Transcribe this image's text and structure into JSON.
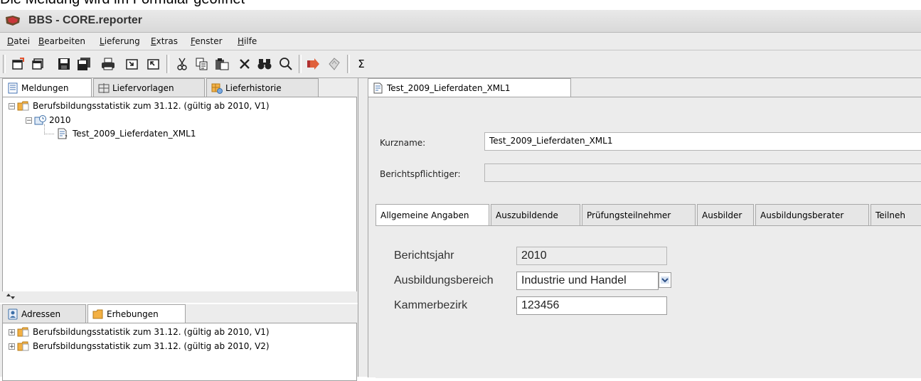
{
  "caption": "Die Meldung wird im Formular geöffnet",
  "window": {
    "title": "BBS - CORE.reporter"
  },
  "menu": [
    {
      "pre": "",
      "u": "D",
      "post": "atei"
    },
    {
      "pre": "",
      "u": "B",
      "post": "earbeiten"
    },
    {
      "pre": "",
      "u": "L",
      "post": "ieferung"
    },
    {
      "pre": "",
      "u": "E",
      "post": "xtras"
    },
    {
      "pre": "",
      "u": "F",
      "post": "enster"
    },
    {
      "pre": "",
      "u": "H",
      "post": "ilfe"
    }
  ],
  "toolbar": {
    "icons": [
      "new-report-icon",
      "new-multi-icon",
      "save-icon",
      "save-all-icon",
      "print-icon",
      "import-icon",
      "export-icon",
      "cut-icon",
      "copy-icon",
      "paste-icon",
      "delete-icon",
      "binoculars-icon",
      "search-icon",
      "send-icon",
      "validate-icon"
    ],
    "sigma": "Σ"
  },
  "left_top": {
    "tabs": [
      "Meldungen",
      "Liefervorlagen",
      "Lieferhistorie"
    ],
    "tree": {
      "root": "Berufsbildungsstatistik zum 31.12. (gültig ab 2010, V1)",
      "year": "2010",
      "leaf": "Test_2009_Lieferdaten_XML1"
    }
  },
  "left_bottom": {
    "tabs": [
      "Adressen",
      "Erhebungen"
    ],
    "tree": [
      "Berufsbildungsstatistik zum 31.12. (gültig ab 2010, V1)",
      "Berufsbildungsstatistik zum 31.12. (gültig ab 2010, V2)"
    ]
  },
  "editor": {
    "tab": "Test_2009_Lieferdaten_XML1",
    "kurzname_label": "Kurzname:",
    "kurzname_value": "Test_2009_Lieferdaten_XML1",
    "berichtspflichtiger_label": "Berichtspflichtiger:",
    "berichtspflichtiger_value": "",
    "subtabs": [
      "Allgemeine Angaben",
      "Auszubildende",
      "Prüfungsteilnehmer",
      "Ausbilder",
      "Ausbildungsberater",
      "Teilneh"
    ],
    "form": {
      "berichtsjahr_label": "Berichtsjahr",
      "berichtsjahr_value": "2010",
      "ausbildungsbereich_label": "Ausbildungsbereich",
      "ausbildungsbereich_value": "Industrie und Handel",
      "kammerbezirk_label": "Kammerbezirk",
      "kammerbezirk_value": "123456"
    }
  },
  "colors": {
    "toolbar_bg": "#ececec",
    "folder": "#f3b042",
    "doc": "#4a78b5"
  }
}
